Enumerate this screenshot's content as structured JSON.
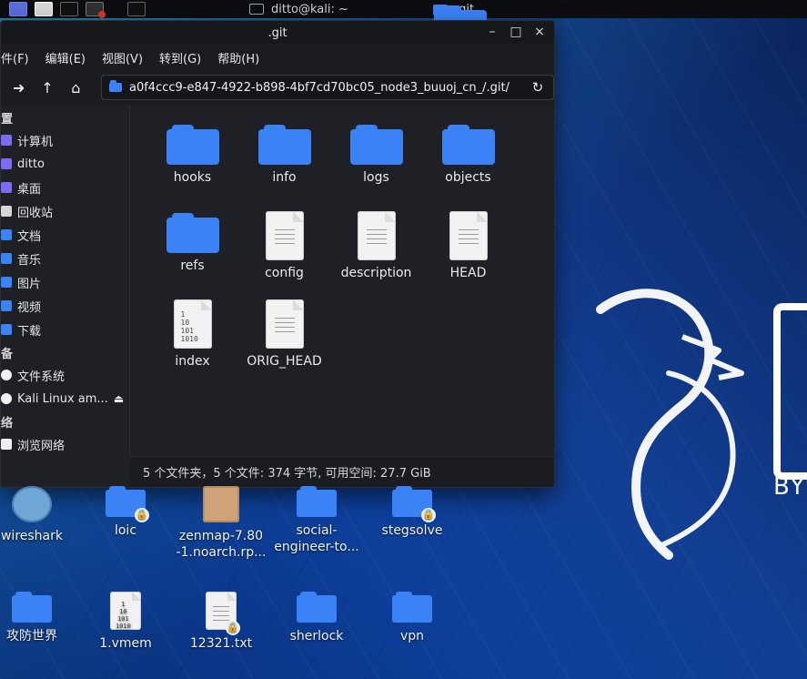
{
  "topbar": {
    "terminal_title": "ditto@kali: ~",
    "folder_title": ".git"
  },
  "window": {
    "title": ".git",
    "menu": [
      "件(F)",
      "编辑(E)",
      "视图(V)",
      "转到(G)",
      "帮助(H)"
    ],
    "path": "a0f4ccc9-e847-4922-b898-4bf7cd70bc05_node3_buuoj_cn_/.git/",
    "sidebar": {
      "sections": [
        {
          "title": "置",
          "items": [
            "计算机",
            "ditto",
            "桌面",
            "回收站",
            "文档",
            "音乐",
            "图片",
            "视频",
            "下载"
          ]
        },
        {
          "title": "备",
          "items": [
            "文件系统",
            "Kali Linux am..."
          ]
        },
        {
          "title": "络",
          "items": [
            "浏览网络"
          ]
        }
      ]
    },
    "files": [
      {
        "name": "hooks",
        "type": "folder"
      },
      {
        "name": "info",
        "type": "folder"
      },
      {
        "name": "logs",
        "type": "folder"
      },
      {
        "name": "objects",
        "type": "folder"
      },
      {
        "name": "refs",
        "type": "folder"
      },
      {
        "name": "config",
        "type": "text"
      },
      {
        "name": "description",
        "type": "text"
      },
      {
        "name": "HEAD",
        "type": "text"
      },
      {
        "name": "index",
        "type": "binary",
        "binary_text": "1\n10\n101\n1010"
      },
      {
        "name": "ORIG_HEAD",
        "type": "text"
      }
    ],
    "status": "5 个文件夹，5 个文件: 374 字节, 可用空间: 27.7 GiB"
  },
  "desktop": {
    "icons_row1": [
      {
        "label": "wireshark"
      },
      {
        "label": "loic"
      },
      {
        "label": "zenmap-7.80\n-1.noarch.rp..."
      },
      {
        "label": "social-\nengineer-to..."
      },
      {
        "label": "stegsolve"
      }
    ],
    "icons_row2": [
      {
        "label": "攻防世界"
      },
      {
        "label": "1.vmem",
        "binary_text": "1\n10\n101\n1010"
      },
      {
        "label": "12321.txt"
      },
      {
        "label": "sherlock"
      },
      {
        "label": "vpn"
      }
    ],
    "brand_text": "BY"
  }
}
